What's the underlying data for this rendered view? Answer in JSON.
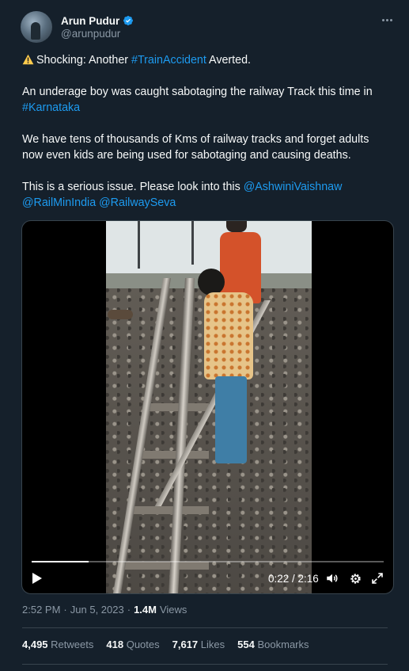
{
  "author": {
    "name": "Arun Pudur",
    "handle": "@arunpudur",
    "avatar_icon": "avatar-photo",
    "verified_icon": "verified-badge-icon"
  },
  "tweet": {
    "line1_prefix": "Shocking: Another ",
    "line1_hashtag": "#TrainAccident",
    "line1_suffix": " Averted.",
    "para2": "An underage boy was caught sabotaging the railway Track this time in",
    "para2_hashtag": "#Karnataka",
    "para3": "We have tens of thousands of Kms of railway tracks and forget adults now even kids are being used for sabotaging and causing deaths.",
    "para4": "This is a serious issue. Please look into this ",
    "mention1": "@AshwiniVaishnaw",
    "mention2": "@RailMinIndia",
    "mention3": "@RailwaySeva"
  },
  "video": {
    "current_time": "0:22",
    "duration": "2:16",
    "time_display": "0:22 / 2:16",
    "progress_fraction": 0.162
  },
  "meta": {
    "time": "2:52 PM",
    "date": "Jun 5, 2023",
    "views_num": "1.4M",
    "views_label": "Views"
  },
  "stats": {
    "retweets_num": "4,495",
    "retweets_label": "Retweets",
    "quotes_num": "418",
    "quotes_label": "Quotes",
    "likes_num": "7,617",
    "likes_label": "Likes",
    "bookmarks_num": "554",
    "bookmarks_label": "Bookmarks"
  },
  "colors": {
    "background": "#15202b",
    "link": "#1d9bf0",
    "secondary_text": "#8b98a5",
    "primary_text": "#f7f9f9"
  }
}
